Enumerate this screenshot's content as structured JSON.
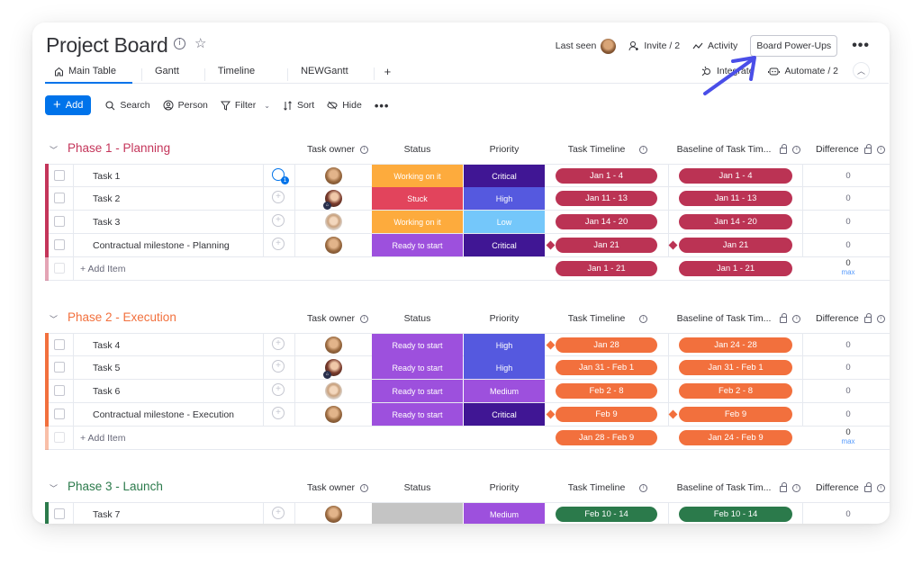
{
  "board": {
    "title": "Project Board",
    "info_icon": "info-icon",
    "star_icon": "star-icon"
  },
  "tabs": [
    {
      "label": "Main Table",
      "icon": "home-icon",
      "active": true
    },
    {
      "label": "Gantt"
    },
    {
      "label": "Timeline"
    },
    {
      "label": "NEWGantt"
    },
    {
      "label": "+"
    }
  ],
  "header_actions": {
    "last_seen": "Last seen",
    "invite": "Invite / 2",
    "activity": "Activity",
    "power_ups": "Board Power-Ups",
    "more": "•••",
    "integrate": "Integrate",
    "automate": "Automate / 2",
    "collapse": "^"
  },
  "toolbar": {
    "add": "Add",
    "search": "Search",
    "person": "Person",
    "filter": "Filter",
    "sort": "Sort",
    "hide": "Hide",
    "more": "•••"
  },
  "columns": {
    "owner": "Task owner",
    "status": "Status",
    "priority": "Priority",
    "timeline": "Task Timeline",
    "baseline": "Baseline of Task Tim...",
    "difference": "Difference"
  },
  "colors": {
    "phase1": "#c4355a",
    "phase1_pill": "#bb3354",
    "phase2": "#f2703d",
    "phase2_pill": "#f2703d",
    "phase3": "#2b7a4b",
    "phase3_pill": "#2b7a4b",
    "working_on_it": "#fdab3d",
    "stuck": "#e2445c",
    "ready_to_start": "#9d50dd",
    "empty_status": "#c4c4c4",
    "critical": "#401694",
    "high": "#5559df",
    "low": "#74c7fa",
    "medium": "#9d50dd",
    "accent_blue": "#0073ea",
    "annotation_arrow": "#4a4ee8"
  },
  "groups": [
    {
      "title": "Phase 1 - Planning",
      "items": [
        {
          "name": "Task 1",
          "updates": "1",
          "status": "Working on it",
          "priority": "Critical",
          "timeline": "Jan 1 - 4",
          "baseline": "Jan 1 - 4",
          "difference": "0"
        },
        {
          "name": "Task 2",
          "status": "Stuck",
          "priority": "High",
          "timeline": "Jan 11 - 13",
          "baseline": "Jan 11 - 13",
          "difference": "0"
        },
        {
          "name": "Task 3",
          "status": "Working on it",
          "priority": "Low",
          "timeline": "Jan 14 - 20",
          "baseline": "Jan 14 - 20",
          "difference": "0"
        },
        {
          "name": "Contractual milestone - Planning",
          "status": "Ready to start",
          "priority": "Critical",
          "timeline": "Jan 21",
          "baseline": "Jan 21",
          "difference": "0"
        }
      ],
      "add_item": "+ Add Item",
      "summary": {
        "timeline": "Jan 1 - 21",
        "baseline": "Jan 1 - 21",
        "difference": "0",
        "difference_label": "max"
      }
    },
    {
      "title": "Phase 2 - Execution",
      "items": [
        {
          "name": "Task 4",
          "status": "Ready to start",
          "priority": "High",
          "timeline": "Jan 28",
          "baseline": "Jan 24 - 28",
          "difference": "0"
        },
        {
          "name": "Task 5",
          "status": "Ready to start",
          "priority": "High",
          "timeline": "Jan 31 - Feb 1",
          "baseline": "Jan 31 - Feb 1",
          "difference": "0"
        },
        {
          "name": "Task 6",
          "status": "Ready to start",
          "priority": "Medium",
          "timeline": "Feb 2 - 8",
          "baseline": "Feb 2 - 8",
          "difference": "0"
        },
        {
          "name": "Contractual milestone - Execution",
          "status": "Ready to start",
          "priority": "Critical",
          "timeline": "Feb 9",
          "baseline": "Feb 9",
          "difference": "0"
        }
      ],
      "add_item": "+ Add Item",
      "summary": {
        "timeline": "Jan 28 - Feb 9",
        "baseline": "Jan 24 - Feb 9",
        "difference": "0",
        "difference_label": "max"
      }
    },
    {
      "title": "Phase 3 - Launch",
      "items": [
        {
          "name": "Task 7",
          "status": "",
          "priority": "Medium",
          "timeline": "Feb 10 - 14",
          "baseline": "Feb 10 - 14",
          "difference": "0"
        }
      ]
    }
  ]
}
